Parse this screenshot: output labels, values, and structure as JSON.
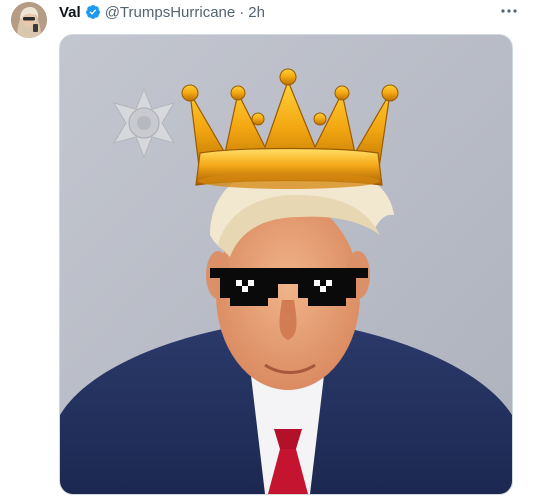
{
  "tweet": {
    "display_name": "Val",
    "handle": "@TrumpsHurricane",
    "separator": "·",
    "timestamp": "2h",
    "more_icon": "more-horizontal-icon",
    "verified_icon": "verified-badge-icon",
    "colors": {
      "name": "#0f1419",
      "secondary_text": "#536471",
      "verified": "#1d9bf0",
      "media_border": "#cfd9de"
    }
  }
}
